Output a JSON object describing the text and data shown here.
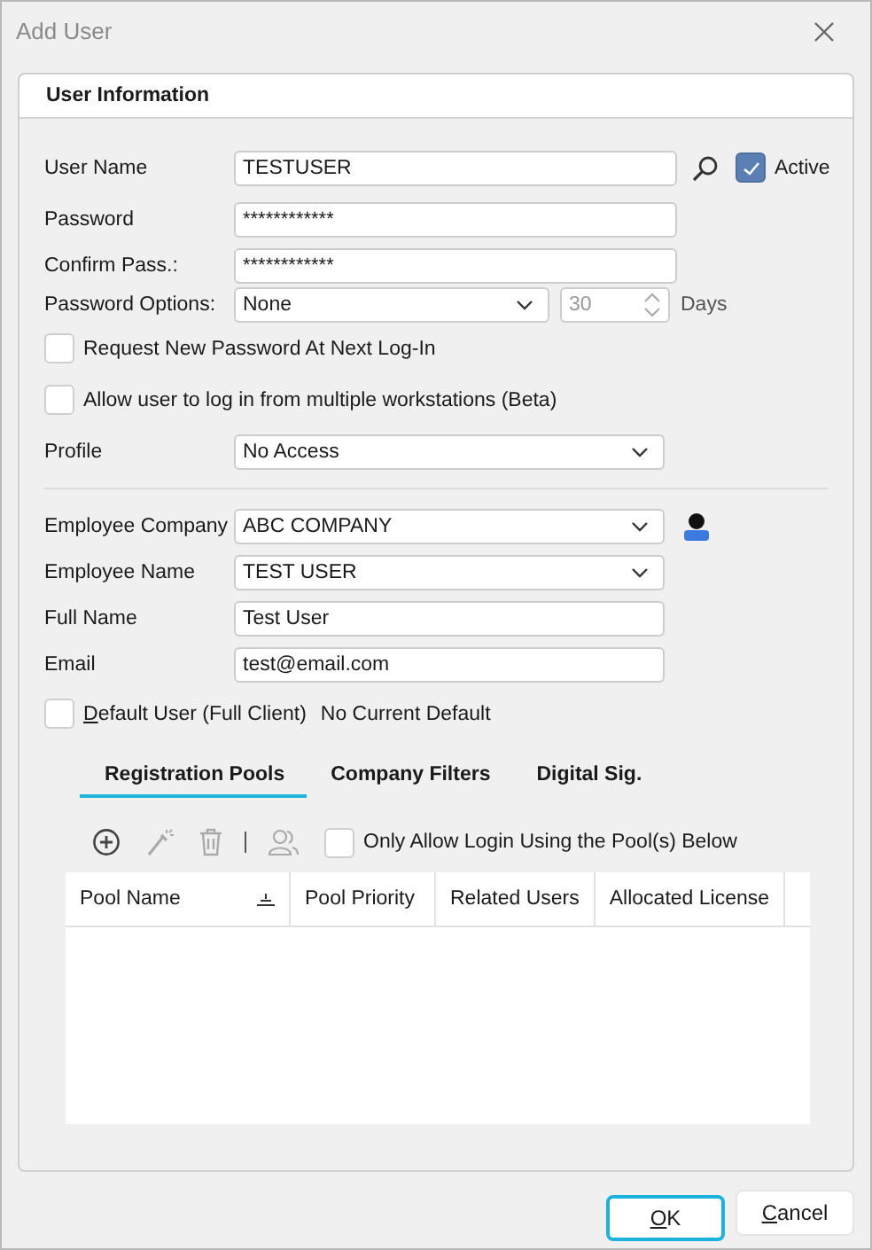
{
  "window": {
    "title": "Add User"
  },
  "group": {
    "title": "User Information"
  },
  "user_name": {
    "label": "User Name",
    "value": "TESTUSER"
  },
  "active": {
    "label": "Active",
    "checked": true
  },
  "password": {
    "label": "Password",
    "value": "************"
  },
  "confirm": {
    "label": "Confirm Pass.:",
    "value": "************"
  },
  "password_options": {
    "label": "Password Options:",
    "value": "None",
    "days_value": "30",
    "days_disabled": true,
    "days_label": "Days"
  },
  "checkboxes": [
    {
      "label": "Request New Password At Next Log-In",
      "checked": false
    },
    {
      "label": "Allow user to log in from multiple workstations (Beta)",
      "checked": false
    }
  ],
  "profile": {
    "label": "Profile",
    "value": "No Access"
  },
  "employee_fields": [
    {
      "kind": "dropdown",
      "label": "Employee Company",
      "value": "ABC COMPANY"
    },
    {
      "kind": "dropdown",
      "label": "Employee Name",
      "value": "TEST USER"
    },
    {
      "kind": "text",
      "label": "Full Name",
      "value": "Test User"
    },
    {
      "kind": "text",
      "label": "Email",
      "value": "test@email.com"
    }
  ],
  "default_user": {
    "label": "Default User (Full Client)",
    "checked": false,
    "mnemonic": true,
    "status": "No Current Default"
  },
  "tabs": [
    {
      "label": "Registration Pools",
      "selected": true
    },
    {
      "label": "Company Filters",
      "selected": false
    },
    {
      "label": "Digital Sig.",
      "selected": false
    }
  ],
  "only_allow": {
    "label": "Only Allow Login Using the Pool(s) Below",
    "checked": false
  },
  "table": {
    "columns": [
      {
        "label": "Pool Name",
        "sorted": true
      },
      {
        "label": "Pool Priority",
        "sorted": false
      },
      {
        "label": "Related Users",
        "sorted": false
      },
      {
        "label": "Allocated License",
        "sorted": false
      }
    ]
  },
  "buttons": [
    {
      "label": "OK",
      "default": true,
      "mnemonic": true
    },
    {
      "label": "Cancel",
      "default": false,
      "mnemonic": true
    }
  ]
}
